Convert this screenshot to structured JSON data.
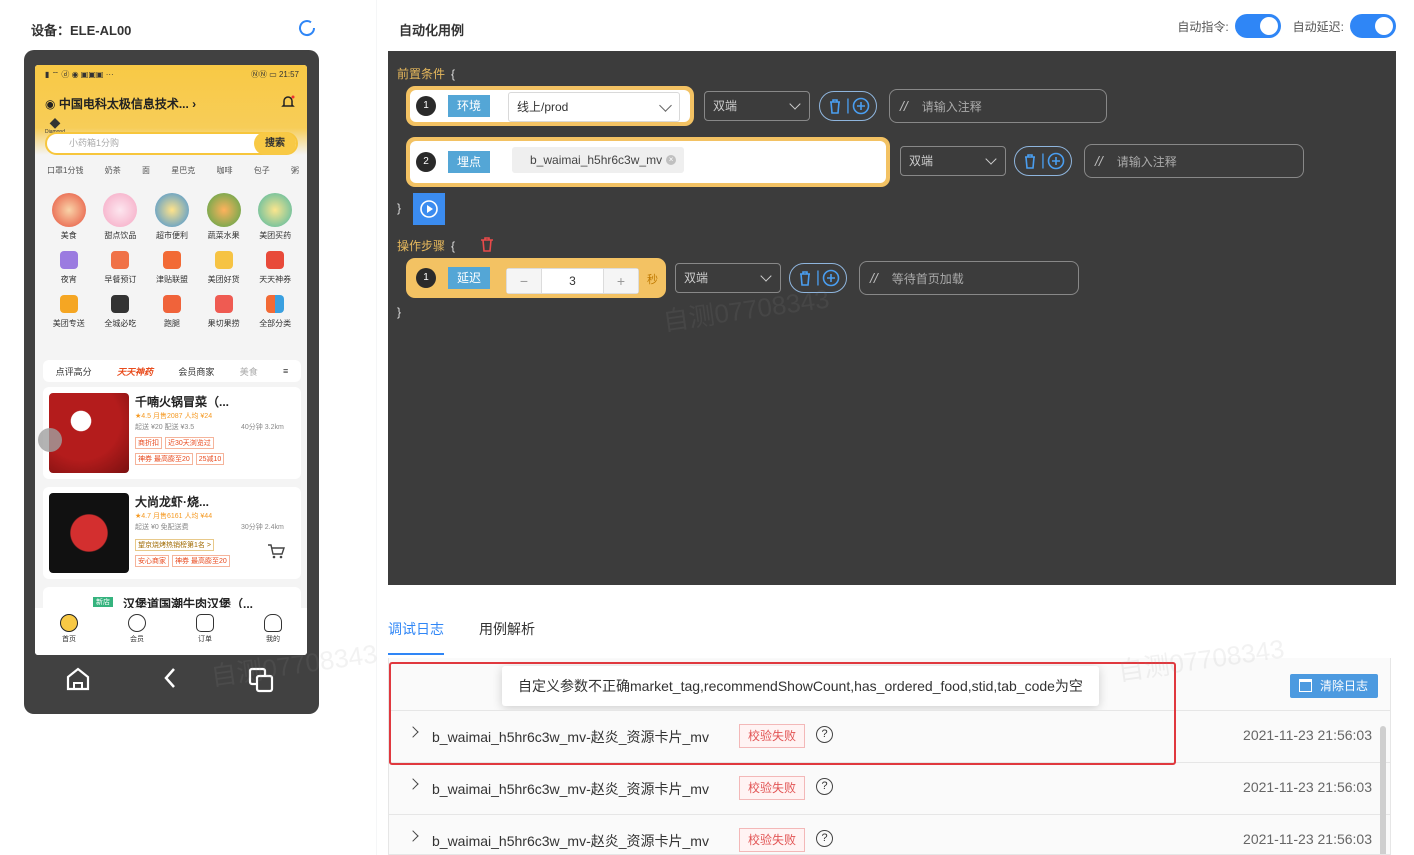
{
  "device": {
    "label": "设备：ELE-AL00"
  },
  "phone": {
    "status_left": "▮ ⌔ ⓓ ◉ ▣▣▣ ···",
    "status_right": "ⓃⓃ ▭ 21:57",
    "location": "中国电科太极信息技术...",
    "diamond_label": "Diamond",
    "search_placeholder": "小药箱1分购",
    "search_button": "搜索",
    "quick_tags": [
      "口罩1分钱",
      "奶茶",
      "面",
      "星巴克",
      "咖啡",
      "包子",
      "粥"
    ],
    "categories_big": [
      "美食",
      "甜点饮品",
      "超市便利",
      "蔬菜水果",
      "美团买药"
    ],
    "categories_small1": [
      "夜宵",
      "早餐预订",
      "津贴联盟",
      "美团好货",
      "天天神券"
    ],
    "categories_small2": [
      "美团专送",
      "全城必吃",
      "跑腿",
      "果切果捞",
      "全部分类"
    ],
    "tabs": [
      "点评高分",
      "天天神药",
      "会员商家",
      "美食"
    ],
    "shops": [
      {
        "name": "千喃火锅冒菜（...",
        "meta1": "★4.5 月售2087 人均 ¥24",
        "meta2": "起送 ¥20 配送 ¥3.5",
        "meta3": "40分钟 3.2km",
        "tags": [
          "商折扣",
          "近30天浏览过"
        ],
        "promo": [
          "神券 最高膨至20",
          "25减10"
        ]
      },
      {
        "name": "大尚龙虾·烧...",
        "meta1": "★4.7 月售6161 人均 ¥44",
        "meta2": "起送 ¥0 免配送费",
        "meta3": "30分钟 2.4km",
        "tags": [
          "望京烧烤热销榜第1名 >"
        ],
        "promo": [
          "安心商家",
          "神券 最高膨至20"
        ]
      },
      {
        "name": "汉堡道国潮牛肉汉堡（...",
        "badge": "新店"
      }
    ],
    "bottom_nav": [
      "首页",
      "会员",
      "订单",
      "我的"
    ]
  },
  "page": {
    "title": "自动化用例",
    "toggle1_label": "自动指令:",
    "toggle2_label": "自动延迟:"
  },
  "editor": {
    "precondition_kw": "前置条件",
    "open_brace": "{",
    "close_brace": "}",
    "steps_kw": "操作步骤",
    "rows": [
      {
        "num": "1",
        "label": "环境",
        "value": "线上/prod",
        "platform": "双端",
        "comment": "请输入注释"
      },
      {
        "num": "2",
        "label": "埋点",
        "chip": "b_waimai_h5hr6c3w_mv",
        "platform": "双端",
        "comment": "请输入注释"
      }
    ],
    "step": {
      "num": "1",
      "label": "延迟",
      "minus": "−",
      "value": "3",
      "plus": "+",
      "unit": "秒",
      "platform": "双端",
      "comment": "等待首页加载"
    },
    "comment_slash": "//"
  },
  "log": {
    "tabs": [
      "调试日志",
      "用例解析"
    ],
    "tooltip": "自定义参数不正确market_tag,recommendShowCount,has_ordered_food,stid,tab_code为空",
    "clear_button": "清除日志",
    "entries": [
      {
        "text": "b_waimai_h5hr6c3w_mv-赵炎_资源卡片_mv",
        "status": "校验失败",
        "time": "2021-11-23 21:56:03"
      },
      {
        "text": "b_waimai_h5hr6c3w_mv-赵炎_资源卡片_mv",
        "status": "校验失败",
        "time": "2021-11-23 21:56:03"
      },
      {
        "text": "b_waimai_h5hr6c3w_mv-赵炎_资源卡片_mv",
        "status": "校验失败",
        "time": "2021-11-23 21:56:03"
      }
    ]
  },
  "watermarks": [
    "自测07708343",
    "自测07708343",
    "自测07708343"
  ],
  "colors": {
    "accent": "#2f86f6",
    "editor_bg": "#3c3c3c",
    "row_frame": "#f3c263",
    "label_bg": "#54a6d6",
    "error": "#e0383e"
  }
}
